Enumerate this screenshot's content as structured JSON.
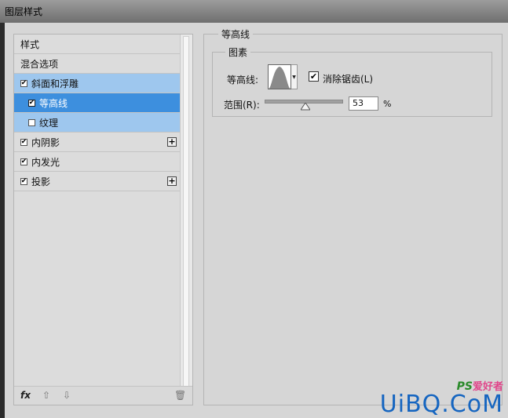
{
  "window": {
    "title": "图层样式"
  },
  "sidebar": {
    "items": [
      {
        "label": "样式",
        "type": "header"
      },
      {
        "label": "混合选项",
        "type": "header"
      },
      {
        "label": "斜面和浮雕",
        "checked": true
      },
      {
        "label": "等高线",
        "checked": true
      },
      {
        "label": "纹理",
        "checked": false
      },
      {
        "label": "内阴影",
        "checked": true,
        "has_add": true
      },
      {
        "label": "内发光",
        "checked": true
      },
      {
        "label": "投影",
        "checked": true,
        "has_add": true
      }
    ],
    "bottom": {
      "fx": "fx",
      "up": "⇧",
      "down": "⇩",
      "trash": "🗑"
    }
  },
  "panel": {
    "title": "等高线",
    "elements": {
      "title": "图素",
      "contour_label": "等高线:",
      "antialias_label": "消除锯齿(L)",
      "antialias_checked": true,
      "range_label": "范围(R):",
      "range_value": "53",
      "range_unit": "%",
      "range_fraction": 0.53
    }
  },
  "watermark": {
    "small_prefix": "PS",
    "small_suffix": "爱好者",
    "big": "UiBQ.CoM",
    "url": "www.psahz.com"
  },
  "colors": {
    "selected_light": "#9ec7ee",
    "selected_dark": "#3d8fde",
    "dialog_bg": "#d6d6d6"
  }
}
